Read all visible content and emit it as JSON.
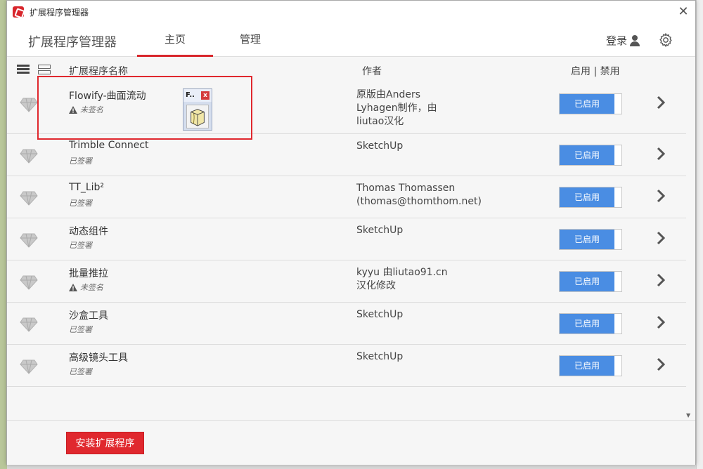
{
  "window": {
    "title": "扩展程序管理器"
  },
  "header": {
    "brand": "扩展程序管理器",
    "tabs": [
      {
        "label": "主页",
        "active": true
      },
      {
        "label": "管理",
        "active": false
      }
    ],
    "login_label": "登录"
  },
  "columns": {
    "name": "扩展程序名称",
    "author": "作者",
    "toggle": "启用 | 禁用"
  },
  "extensions": [
    {
      "name": "Flowify-曲面流动",
      "signature": "未签名",
      "signed": false,
      "author": [
        "原版由Anders",
        "Lyhagen制作，由",
        "liutao汉化"
      ],
      "status": "已启用"
    },
    {
      "name": "Trimble Connect",
      "signature": "已签署",
      "signed": true,
      "author": [
        "SketchUp"
      ],
      "status": "已启用"
    },
    {
      "name": "TT_Lib²",
      "signature": "已签署",
      "signed": true,
      "author": [
        "Thomas Thomassen",
        "(thomas@thomthom.net)"
      ],
      "status": "已启用"
    },
    {
      "name": "动态组件",
      "signature": "已签署",
      "signed": true,
      "author": [
        "SketchUp"
      ],
      "status": "已启用"
    },
    {
      "name": "批量推拉",
      "signature": "未签名",
      "signed": false,
      "author": [
        "kyyu 由liutao91.cn",
        "汉化修改"
      ],
      "status": "已启用"
    },
    {
      "name": "沙盒工具",
      "signature": "已签署",
      "signed": true,
      "author": [
        "SketchUp"
      ],
      "status": "已启用"
    },
    {
      "name": "高级镜头工具",
      "signature": "已签署",
      "signed": true,
      "author": [
        "SketchUp"
      ],
      "status": "已启用"
    }
  ],
  "popup": {
    "title": "F..",
    "close": "x"
  },
  "footer": {
    "install_label": "安装扩展程序"
  },
  "colors": {
    "accent_red": "#e0282e",
    "toggle_blue": "#4a8de3"
  }
}
